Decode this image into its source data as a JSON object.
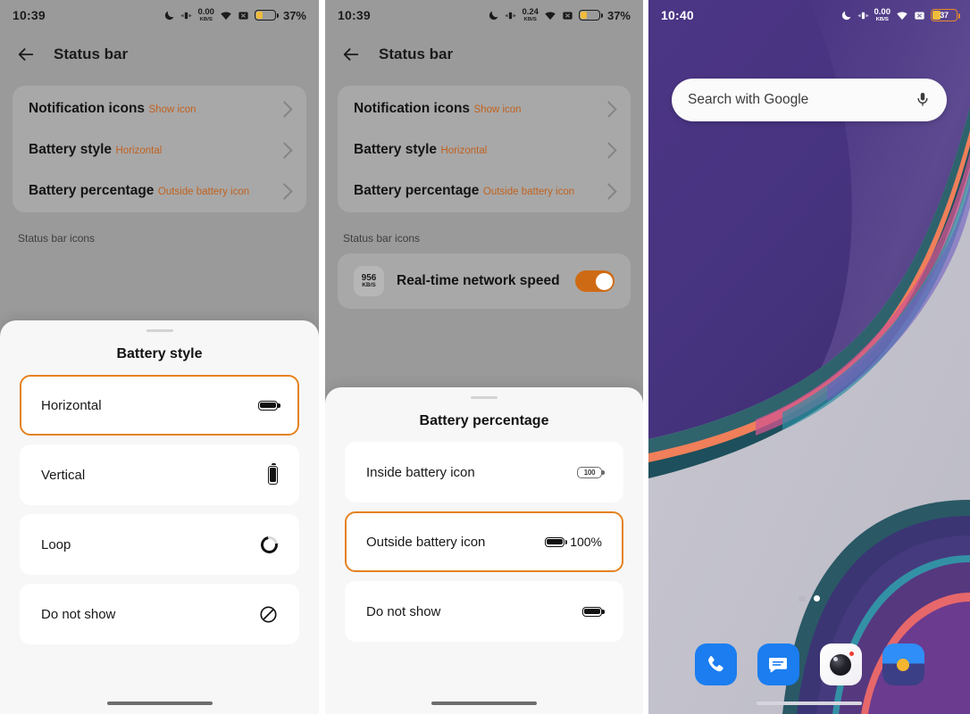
{
  "panels": [
    {
      "id": "panel-1",
      "statusbar": {
        "time": "10:39",
        "network_speed_value": "0.00",
        "network_speed_unit": "KB/S",
        "battery_percent_label": "37%",
        "battery_level": 37,
        "icons": [
          "dnd-moon-icon",
          "vibrate-icon",
          "network-speed-icon",
          "wifi-icon",
          "no-sim-icon",
          "battery-icon"
        ]
      },
      "appbar": {
        "title": "Status bar",
        "back": "back-arrow"
      },
      "settings_rows": [
        {
          "title": "Notification icons",
          "subtitle": "Show icon"
        },
        {
          "title": "Battery style",
          "subtitle": "Horizontal"
        },
        {
          "title": "Battery percentage",
          "subtitle": "Outside battery icon"
        }
      ],
      "section_label": "Status bar icons",
      "sheet": {
        "title": "Battery style",
        "options": [
          {
            "label": "Horizontal",
            "icon": "battery-horizontal-icon",
            "selected": true
          },
          {
            "label": "Vertical",
            "icon": "battery-vertical-icon",
            "selected": false
          },
          {
            "label": "Loop",
            "icon": "battery-loop-icon",
            "selected": false
          },
          {
            "label": "Do not show",
            "icon": "do-not-show-icon",
            "selected": false
          }
        ]
      }
    },
    {
      "id": "panel-2",
      "statusbar": {
        "time": "10:39",
        "network_speed_value": "0.24",
        "network_speed_unit": "KB/S",
        "battery_percent_label": "37%",
        "battery_level": 37,
        "icons": [
          "dnd-moon-icon",
          "vibrate-icon",
          "network-speed-icon",
          "wifi-icon",
          "no-sim-icon",
          "battery-icon"
        ]
      },
      "appbar": {
        "title": "Status bar",
        "back": "back-arrow"
      },
      "settings_rows": [
        {
          "title": "Notification icons",
          "subtitle": "Show icon"
        },
        {
          "title": "Battery style",
          "subtitle": "Horizontal"
        },
        {
          "title": "Battery percentage",
          "subtitle": "Outside battery icon"
        }
      ],
      "section_label": "Status bar icons",
      "toggle_row": {
        "chip_value": "956",
        "chip_unit": "KB/S",
        "label": "Real-time network speed",
        "enabled": true,
        "accent": "#cf6a14"
      },
      "sheet": {
        "title": "Battery percentage",
        "options": [
          {
            "label": "Inside battery icon",
            "icon": "battery-inside-percent-icon",
            "badge": "100",
            "selected": false
          },
          {
            "label": "Outside battery icon",
            "icon": "battery-horizontal-icon",
            "pct": "100%",
            "selected": true
          },
          {
            "label": "Do not show",
            "icon": "battery-horizontal-icon",
            "selected": false
          }
        ]
      }
    },
    {
      "id": "panel-3",
      "statusbar": {
        "time": "10:40",
        "network_speed_value": "0.00",
        "network_speed_unit": "KB/S",
        "battery_percent_label": "37",
        "battery_level": 37,
        "icons": [
          "dnd-moon-icon",
          "vibrate-icon",
          "network-speed-icon",
          "wifi-icon",
          "no-sim-icon",
          "battery-inside-percent-icon"
        ]
      },
      "search": {
        "placeholder": "Search with Google",
        "mic": "microphone-icon"
      },
      "page_indicator": {
        "pages": 2,
        "active": 2
      },
      "dock": [
        {
          "name": "phone-app-icon",
          "label": "Phone"
        },
        {
          "name": "messages-app-icon",
          "label": "Messages"
        },
        {
          "name": "camera-app-icon",
          "label": "Camera"
        },
        {
          "name": "gallery-app-icon",
          "label": "Gallery"
        }
      ]
    }
  ],
  "theme": {
    "accent_orange": "#e4821f",
    "subtitle_orange": "#c1621f",
    "toggle_on": "#cf6a14",
    "scrim": "#9a9a9a",
    "sheet_bg": "#f7f7f7",
    "battery_fill_yellow": "#f0bc3c",
    "wallpaper_purple": "#4a3580"
  }
}
